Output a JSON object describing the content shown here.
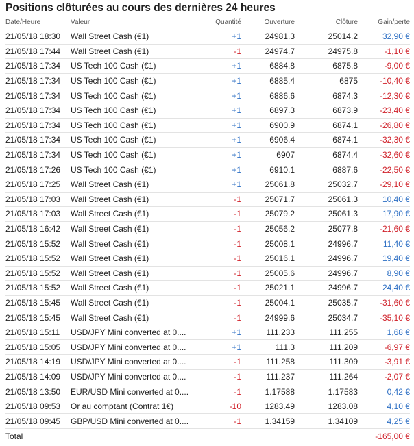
{
  "title": "Positions clôturées au cours des dernières 24 heures",
  "columns": {
    "date": "Date/Heure",
    "value": "Valeur",
    "qty": "Quantité",
    "open": "Ouverture",
    "close": "Clôture",
    "gain": "Gain/perte"
  },
  "rows": [
    {
      "date": "21/05/18 18:30",
      "value": "Wall Street Cash (€1)",
      "qty": "+1",
      "open": "24981.3",
      "close": "25014.2",
      "gain": "32,90 €"
    },
    {
      "date": "21/05/18 17:44",
      "value": "Wall Street Cash (€1)",
      "qty": "-1",
      "open": "24974.7",
      "close": "24975.8",
      "gain": "-1,10 €"
    },
    {
      "date": "21/05/18 17:34",
      "value": "US Tech 100 Cash (€1)",
      "qty": "+1",
      "open": "6884.8",
      "close": "6875.8",
      "gain": "-9,00 €"
    },
    {
      "date": "21/05/18 17:34",
      "value": "US Tech 100 Cash (€1)",
      "qty": "+1",
      "open": "6885.4",
      "close": "6875",
      "gain": "-10,40 €"
    },
    {
      "date": "21/05/18 17:34",
      "value": "US Tech 100 Cash (€1)",
      "qty": "+1",
      "open": "6886.6",
      "close": "6874.3",
      "gain": "-12,30 €"
    },
    {
      "date": "21/05/18 17:34",
      "value": "US Tech 100 Cash (€1)",
      "qty": "+1",
      "open": "6897.3",
      "close": "6873.9",
      "gain": "-23,40 €"
    },
    {
      "date": "21/05/18 17:34",
      "value": "US Tech 100 Cash (€1)",
      "qty": "+1",
      "open": "6900.9",
      "close": "6874.1",
      "gain": "-26,80 €"
    },
    {
      "date": "21/05/18 17:34",
      "value": "US Tech 100 Cash (€1)",
      "qty": "+1",
      "open": "6906.4",
      "close": "6874.1",
      "gain": "-32,30 €"
    },
    {
      "date": "21/05/18 17:34",
      "value": "US Tech 100 Cash (€1)",
      "qty": "+1",
      "open": "6907",
      "close": "6874.4",
      "gain": "-32,60 €"
    },
    {
      "date": "21/05/18 17:26",
      "value": "US Tech 100 Cash (€1)",
      "qty": "+1",
      "open": "6910.1",
      "close": "6887.6",
      "gain": "-22,50 €"
    },
    {
      "date": "21/05/18 17:25",
      "value": "Wall Street Cash (€1)",
      "qty": "+1",
      "open": "25061.8",
      "close": "25032.7",
      "gain": "-29,10 €"
    },
    {
      "date": "21/05/18 17:03",
      "value": "Wall Street Cash (€1)",
      "qty": "-1",
      "open": "25071.7",
      "close": "25061.3",
      "gain": "10,40 €"
    },
    {
      "date": "21/05/18 17:03",
      "value": "Wall Street Cash (€1)",
      "qty": "-1",
      "open": "25079.2",
      "close": "25061.3",
      "gain": "17,90 €"
    },
    {
      "date": "21/05/18 16:42",
      "value": "Wall Street Cash (€1)",
      "qty": "-1",
      "open": "25056.2",
      "close": "25077.8",
      "gain": "-21,60 €"
    },
    {
      "date": "21/05/18 15:52",
      "value": "Wall Street Cash (€1)",
      "qty": "-1",
      "open": "25008.1",
      "close": "24996.7",
      "gain": "11,40 €"
    },
    {
      "date": "21/05/18 15:52",
      "value": "Wall Street Cash (€1)",
      "qty": "-1",
      "open": "25016.1",
      "close": "24996.7",
      "gain": "19,40 €"
    },
    {
      "date": "21/05/18 15:52",
      "value": "Wall Street Cash (€1)",
      "qty": "-1",
      "open": "25005.6",
      "close": "24996.7",
      "gain": "8,90 €"
    },
    {
      "date": "21/05/18 15:52",
      "value": "Wall Street Cash (€1)",
      "qty": "-1",
      "open": "25021.1",
      "close": "24996.7",
      "gain": "24,40 €"
    },
    {
      "date": "21/05/18 15:45",
      "value": "Wall Street Cash (€1)",
      "qty": "-1",
      "open": "25004.1",
      "close": "25035.7",
      "gain": "-31,60 €"
    },
    {
      "date": "21/05/18 15:45",
      "value": "Wall Street Cash (€1)",
      "qty": "-1",
      "open": "24999.6",
      "close": "25034.7",
      "gain": "-35,10 €"
    },
    {
      "date": "21/05/18 15:11",
      "value": "USD/JPY Mini converted at 0....",
      "qty": "+1",
      "open": "111.233",
      "close": "111.255",
      "gain": "1,68 €"
    },
    {
      "date": "21/05/18 15:05",
      "value": "USD/JPY Mini converted at 0....",
      "qty": "+1",
      "open": "111.3",
      "close": "111.209",
      "gain": "-6,97 €"
    },
    {
      "date": "21/05/18 14:19",
      "value": "USD/JPY Mini converted at 0....",
      "qty": "-1",
      "open": "111.258",
      "close": "111.309",
      "gain": "-3,91 €"
    },
    {
      "date": "21/05/18 14:09",
      "value": "USD/JPY Mini converted at 0....",
      "qty": "-1",
      "open": "111.237",
      "close": "111.264",
      "gain": "-2,07 €"
    },
    {
      "date": "21/05/18 13:50",
      "value": "EUR/USD Mini converted at 0....",
      "qty": "-1",
      "open": "1.17588",
      "close": "1.17583",
      "gain": "0,42 €"
    },
    {
      "date": "21/05/18 09:53",
      "value": "Or au comptant (Contrat 1€)",
      "qty": "-10",
      "open": "1283.49",
      "close": "1283.08",
      "gain": "4,10 €"
    },
    {
      "date": "21/05/18 09:45",
      "value": "GBP/USD Mini converted at 0....",
      "qty": "-1",
      "open": "1.34159",
      "close": "1.34109",
      "gain": "4,25 €"
    }
  ],
  "total": {
    "label": "Total",
    "gain": "-165,00 €"
  },
  "colors": {
    "positive": "#2d6fc4",
    "negative": "#d0212a"
  }
}
